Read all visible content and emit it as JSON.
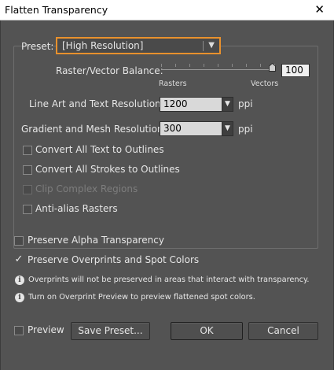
{
  "window": {
    "title": "Flatten Transparency",
    "close_glyph": "✕"
  },
  "preset": {
    "label": "Preset:",
    "value": "[High Resolution]"
  },
  "balance": {
    "label": "Raster/Vector Balance:",
    "value": "100",
    "level": 100,
    "left_label": "Rasters",
    "right_label": "Vectors"
  },
  "line_art": {
    "label": "Line Art and Text Resolution:",
    "value": "1200",
    "unit": "ppi"
  },
  "gradient": {
    "label": "Gradient and Mesh Resolution:",
    "value": "300",
    "unit": "ppi"
  },
  "options": {
    "text_outlines": {
      "label": "Convert All Text to Outlines",
      "checked": false
    },
    "stroke_outlines": {
      "label": "Convert All Strokes to Outlines",
      "checked": false
    },
    "clip_regions": {
      "label": "Clip Complex Regions",
      "checked": false,
      "disabled": true
    },
    "antialias": {
      "label": "Anti-alias Rasters",
      "checked": false
    }
  },
  "preserve_alpha": {
    "label": "Preserve Alpha Transparency",
    "checked": false
  },
  "preserve_overprints": {
    "label": "Preserve Overprints and Spot Colors",
    "checked": true
  },
  "info": {
    "line1": "Overprints will not be preserved in areas that interact with transparency.",
    "line2": "Turn on Overprint Preview to preview flattened spot colors.",
    "glyph": "i"
  },
  "footer": {
    "preview_label": "Preview",
    "save_preset": "Save Preset...",
    "ok": "OK",
    "cancel": "Cancel"
  },
  "colors": {
    "background": "#535353",
    "focus_ring": "#e8912d"
  },
  "icons": {
    "dropdown_arrow": "▼",
    "check": "✓"
  }
}
